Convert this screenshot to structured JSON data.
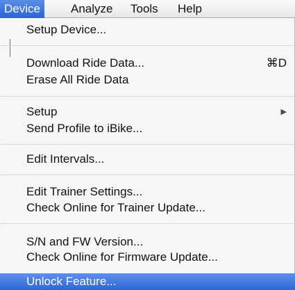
{
  "menubar": {
    "items": [
      {
        "label": "Device",
        "active": true
      },
      {
        "label": "Analyze",
        "active": false
      },
      {
        "label": "Tools",
        "active": false
      },
      {
        "label": "Help",
        "active": false
      }
    ]
  },
  "menu": {
    "items": [
      {
        "label": "Setup Device...",
        "shortcut": "",
        "has_submenu": false
      },
      {
        "label": "Download Ride Data...",
        "shortcut": "⌘D",
        "has_submenu": false
      },
      {
        "label": "Erase All Ride Data",
        "shortcut": "",
        "has_submenu": false
      },
      {
        "label": "Setup",
        "shortcut": "",
        "has_submenu": true
      },
      {
        "label": "Send Profile to iBike...",
        "shortcut": "",
        "has_submenu": false
      },
      {
        "label": "Edit Intervals...",
        "shortcut": "",
        "has_submenu": false
      },
      {
        "label": "Edit Trainer Settings...",
        "shortcut": "",
        "has_submenu": false
      },
      {
        "label": "Check Online for Trainer Update...",
        "shortcut": "",
        "has_submenu": false
      },
      {
        "label": "S/N and FW Version...",
        "shortcut": "",
        "has_submenu": false
      },
      {
        "label": "Check Online for Firmware Update...",
        "shortcut": "",
        "has_submenu": false
      },
      {
        "label": "Unlock Feature...",
        "shortcut": "",
        "has_submenu": false,
        "highlighted": true
      }
    ]
  },
  "icons": {
    "submenu_arrow": "triangle-right-icon"
  }
}
